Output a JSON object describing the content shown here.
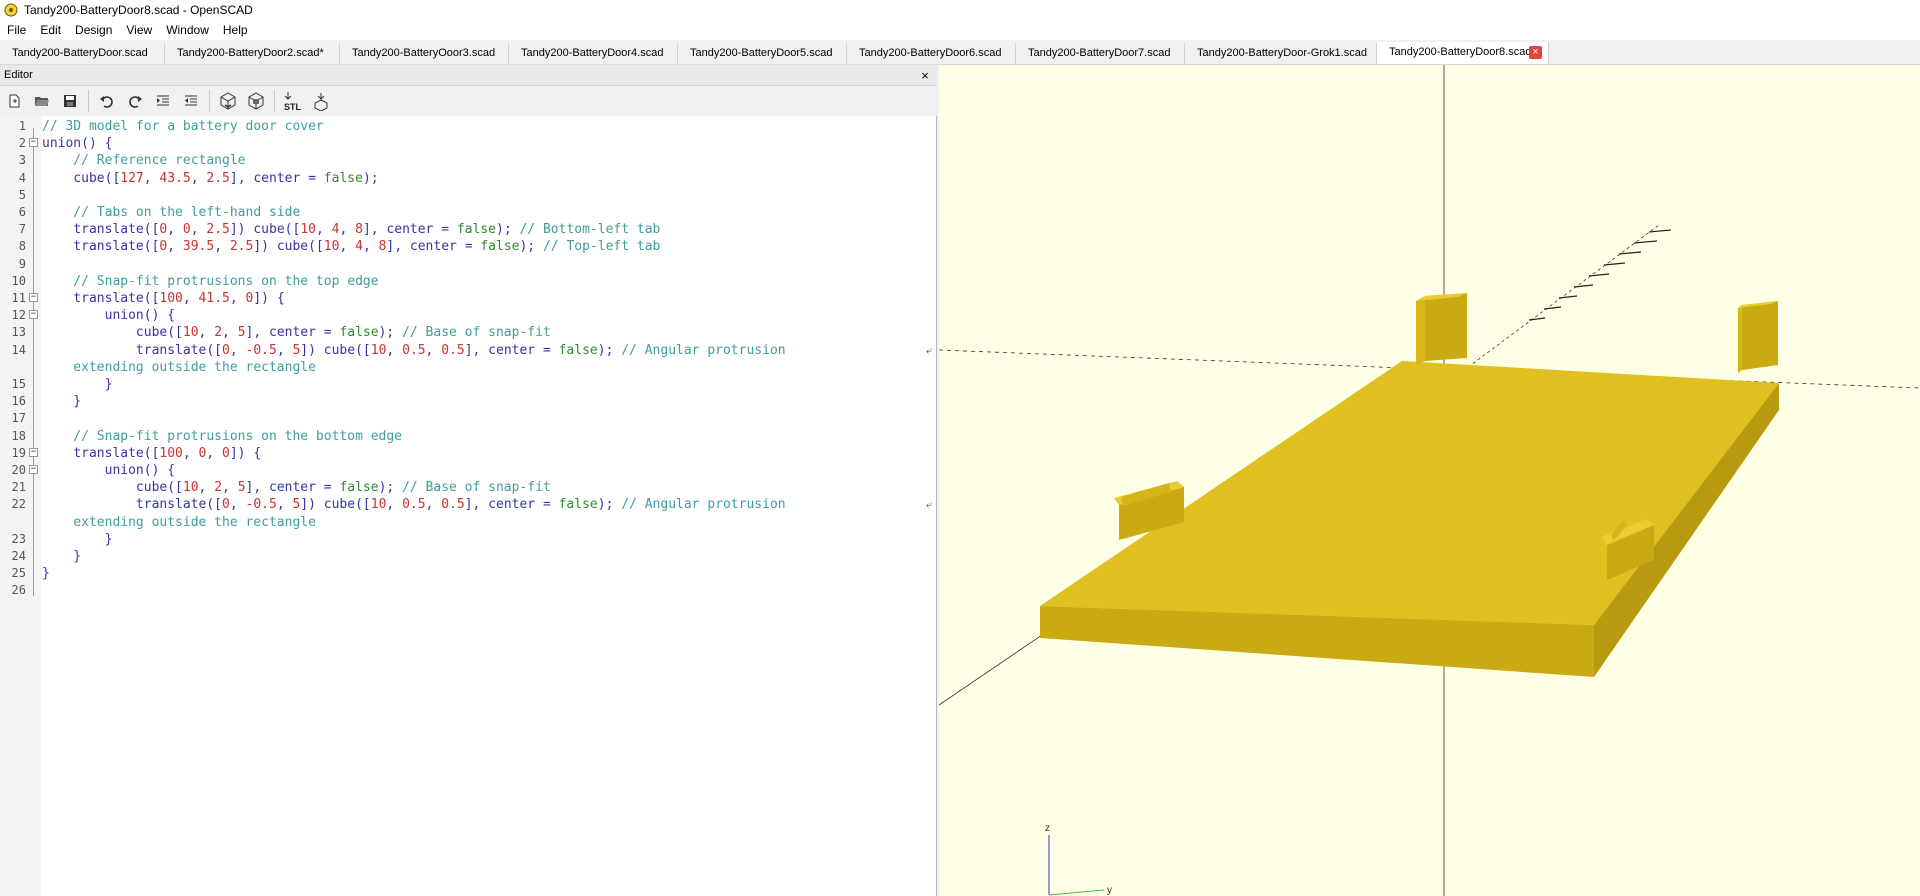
{
  "window": {
    "title": "Tandy200-BatteryDoor8.scad - OpenSCAD",
    "icon": "openscad-logo-icon"
  },
  "menu": [
    "File",
    "Edit",
    "Design",
    "View",
    "Window",
    "Help"
  ],
  "tabs": [
    {
      "label": "Tandy200-BatteryDoor.scad"
    },
    {
      "label": "Tandy200-BatteryDoor2.scad*"
    },
    {
      "label": "Tandy200-BatteryOoor3.scad"
    },
    {
      "label": "Tandy200-BatteryDoor4.scad"
    },
    {
      "label": "Tandy200-BatteryDoor5.scad"
    },
    {
      "label": "Tandy200-BatteryDoor6.scad"
    },
    {
      "label": "Tandy200-BatteryDoor7.scad"
    },
    {
      "label": "Tandy200-BatteryDoor-Grok1.scad"
    },
    {
      "label": "Tandy200-BatteryDoor8.scad",
      "active": true
    }
  ],
  "editor": {
    "title": "Editor",
    "close": "×"
  },
  "toolbar": [
    "new-file-icon",
    "open-file-icon",
    "save-icon",
    "undo-icon",
    "redo-icon",
    "indent-icon",
    "unindent-icon",
    "preview-icon",
    "render-icon",
    "export-stl-icon",
    "send-to-print-icon"
  ],
  "toolbar_stl_label": "STL",
  "code": {
    "lines": [
      {
        "n": "1",
        "t": [
          [
            "c",
            "// 3D model for a battery door cover"
          ]
        ]
      },
      {
        "n": "2",
        "fold": true,
        "t": [
          [
            "k",
            "union() {"
          ]
        ]
      },
      {
        "n": "3",
        "t": [
          [
            "c",
            "    // Reference rectangle"
          ]
        ]
      },
      {
        "n": "4",
        "t": [
          [
            "k",
            "    cube(["
          ],
          [
            "n",
            "127"
          ],
          [
            "k",
            ", "
          ],
          [
            "n",
            "43.5"
          ],
          [
            "k",
            ", "
          ],
          [
            "n",
            "2.5"
          ],
          [
            "k",
            "], center = "
          ],
          [
            "b",
            "false"
          ],
          [
            "k",
            ");"
          ]
        ]
      },
      {
        "n": "5",
        "t": []
      },
      {
        "n": "6",
        "t": [
          [
            "c",
            "    // Tabs on the left-hand side"
          ]
        ]
      },
      {
        "n": "7",
        "t": [
          [
            "k",
            "    translate(["
          ],
          [
            "n",
            "0"
          ],
          [
            "k",
            ", "
          ],
          [
            "n",
            "0"
          ],
          [
            "k",
            ", "
          ],
          [
            "n",
            "2.5"
          ],
          [
            "k",
            "]) cube(["
          ],
          [
            "n",
            "10"
          ],
          [
            "k",
            ", "
          ],
          [
            "n",
            "4"
          ],
          [
            "k",
            ", "
          ],
          [
            "n",
            "8"
          ],
          [
            "k",
            "], center = "
          ],
          [
            "b",
            "false"
          ],
          [
            "k",
            "); "
          ],
          [
            "c",
            "// Bottom-left tab"
          ]
        ]
      },
      {
        "n": "8",
        "t": [
          [
            "k",
            "    translate(["
          ],
          [
            "n",
            "0"
          ],
          [
            "k",
            ", "
          ],
          [
            "n",
            "39.5"
          ],
          [
            "k",
            ", "
          ],
          [
            "n",
            "2.5"
          ],
          [
            "k",
            "]) cube(["
          ],
          [
            "n",
            "10"
          ],
          [
            "k",
            ", "
          ],
          [
            "n",
            "4"
          ],
          [
            "k",
            ", "
          ],
          [
            "n",
            "8"
          ],
          [
            "k",
            "], center = "
          ],
          [
            "b",
            "false"
          ],
          [
            "k",
            "); "
          ],
          [
            "c",
            "// Top-left tab"
          ]
        ]
      },
      {
        "n": "9",
        "t": []
      },
      {
        "n": "10",
        "t": [
          [
            "c",
            "    // Snap-fit protrusions on the top edge"
          ]
        ]
      },
      {
        "n": "11",
        "fold": true,
        "t": [
          [
            "k",
            "    translate(["
          ],
          [
            "n",
            "100"
          ],
          [
            "k",
            ", "
          ],
          [
            "n",
            "41.5"
          ],
          [
            "k",
            ", "
          ],
          [
            "n",
            "0"
          ],
          [
            "k",
            "]) {"
          ]
        ]
      },
      {
        "n": "12",
        "fold": true,
        "t": [
          [
            "k",
            "        union() {"
          ]
        ]
      },
      {
        "n": "13",
        "t": [
          [
            "k",
            "            cube(["
          ],
          [
            "n",
            "10"
          ],
          [
            "k",
            ", "
          ],
          [
            "n",
            "2"
          ],
          [
            "k",
            ", "
          ],
          [
            "n",
            "5"
          ],
          [
            "k",
            "], center = "
          ],
          [
            "b",
            "false"
          ],
          [
            "k",
            "); "
          ],
          [
            "c",
            "// Base of snap-fit"
          ]
        ]
      },
      {
        "n": "14",
        "wrap": true,
        "t": [
          [
            "k",
            "            translate(["
          ],
          [
            "n",
            "0"
          ],
          [
            "k",
            ", "
          ],
          [
            "n",
            "-0.5"
          ],
          [
            "k",
            ", "
          ],
          [
            "n",
            "5"
          ],
          [
            "k",
            "]) cube(["
          ],
          [
            "n",
            "10"
          ],
          [
            "k",
            ", "
          ],
          [
            "n",
            "0.5"
          ],
          [
            "k",
            ", "
          ],
          [
            "n",
            "0.5"
          ],
          [
            "k",
            "], center = "
          ],
          [
            "b",
            "false"
          ],
          [
            "k",
            "); "
          ],
          [
            "c",
            "// Angular protrusion"
          ]
        ]
      },
      {
        "n": "",
        "t": [
          [
            "c",
            "    extending outside the rectangle"
          ]
        ]
      },
      {
        "n": "15",
        "t": [
          [
            "k",
            "        }"
          ]
        ]
      },
      {
        "n": "16",
        "t": [
          [
            "k",
            "    }"
          ]
        ]
      },
      {
        "n": "17",
        "t": []
      },
      {
        "n": "18",
        "t": [
          [
            "c",
            "    // Snap-fit protrusions on the bottom edge"
          ]
        ]
      },
      {
        "n": "19",
        "fold": true,
        "t": [
          [
            "k",
            "    translate(["
          ],
          [
            "n",
            "100"
          ],
          [
            "k",
            ", "
          ],
          [
            "n",
            "0"
          ],
          [
            "k",
            ", "
          ],
          [
            "n",
            "0"
          ],
          [
            "k",
            "]) {"
          ]
        ]
      },
      {
        "n": "20",
        "fold": true,
        "t": [
          [
            "k",
            "        union() {"
          ]
        ]
      },
      {
        "n": "21",
        "t": [
          [
            "k",
            "            cube(["
          ],
          [
            "n",
            "10"
          ],
          [
            "k",
            ", "
          ],
          [
            "n",
            "2"
          ],
          [
            "k",
            ", "
          ],
          [
            "n",
            "5"
          ],
          [
            "k",
            "], center = "
          ],
          [
            "b",
            "false"
          ],
          [
            "k",
            "); "
          ],
          [
            "c",
            "// Base of snap-fit"
          ]
        ]
      },
      {
        "n": "22",
        "wrap": true,
        "t": [
          [
            "k",
            "            translate(["
          ],
          [
            "n",
            "0"
          ],
          [
            "k",
            ", "
          ],
          [
            "n",
            "-0.5"
          ],
          [
            "k",
            ", "
          ],
          [
            "n",
            "5"
          ],
          [
            "k",
            "]) cube(["
          ],
          [
            "n",
            "10"
          ],
          [
            "k",
            ", "
          ],
          [
            "n",
            "0.5"
          ],
          [
            "k",
            ", "
          ],
          [
            "n",
            "0.5"
          ],
          [
            "k",
            "], center = "
          ],
          [
            "b",
            "false"
          ],
          [
            "k",
            "); "
          ],
          [
            "c",
            "// Angular protrusion"
          ]
        ]
      },
      {
        "n": "",
        "t": [
          [
            "c",
            "    extending outside the rectangle"
          ]
        ]
      },
      {
        "n": "23",
        "t": [
          [
            "k",
            "        }"
          ]
        ]
      },
      {
        "n": "24",
        "t": [
          [
            "k",
            "    }"
          ]
        ]
      },
      {
        "n": "25",
        "t": [
          [
            "k",
            "}"
          ]
        ]
      },
      {
        "n": "26",
        "t": []
      }
    ]
  },
  "viewport": {
    "background": "#ffffe6",
    "model_color": "#e0c020",
    "axis_label_z": "z",
    "axis_label_y": "y"
  }
}
